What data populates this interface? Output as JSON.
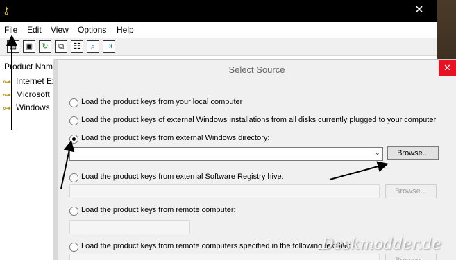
{
  "main_window": {
    "close_glyph": "✕",
    "menu": [
      "File",
      "Edit",
      "View",
      "Options",
      "Help"
    ],
    "column_header": "Product Nam",
    "rows": [
      "Internet Ex",
      "Microsoft",
      "Windows"
    ]
  },
  "dialog": {
    "title": "Select Source",
    "close_glyph": "✕",
    "options": [
      "Load the product keys from your local computer",
      "Load the product keys of external Windows installations from all disks currently plugged to your computer",
      "Load the product keys from external Windows directory:",
      "Load the product keys from external Software Registry hive:",
      "Load the product keys from remote computer:",
      "Load the product keys from remote computers specified in the following text file:"
    ],
    "selected_option": 2,
    "browse_label": "Browse...",
    "combo_value": ""
  },
  "watermark": "Deskmodder.de",
  "colors": {
    "dialog_close": "#e81123",
    "titlebar": "#000000",
    "arrow": "#000000"
  }
}
